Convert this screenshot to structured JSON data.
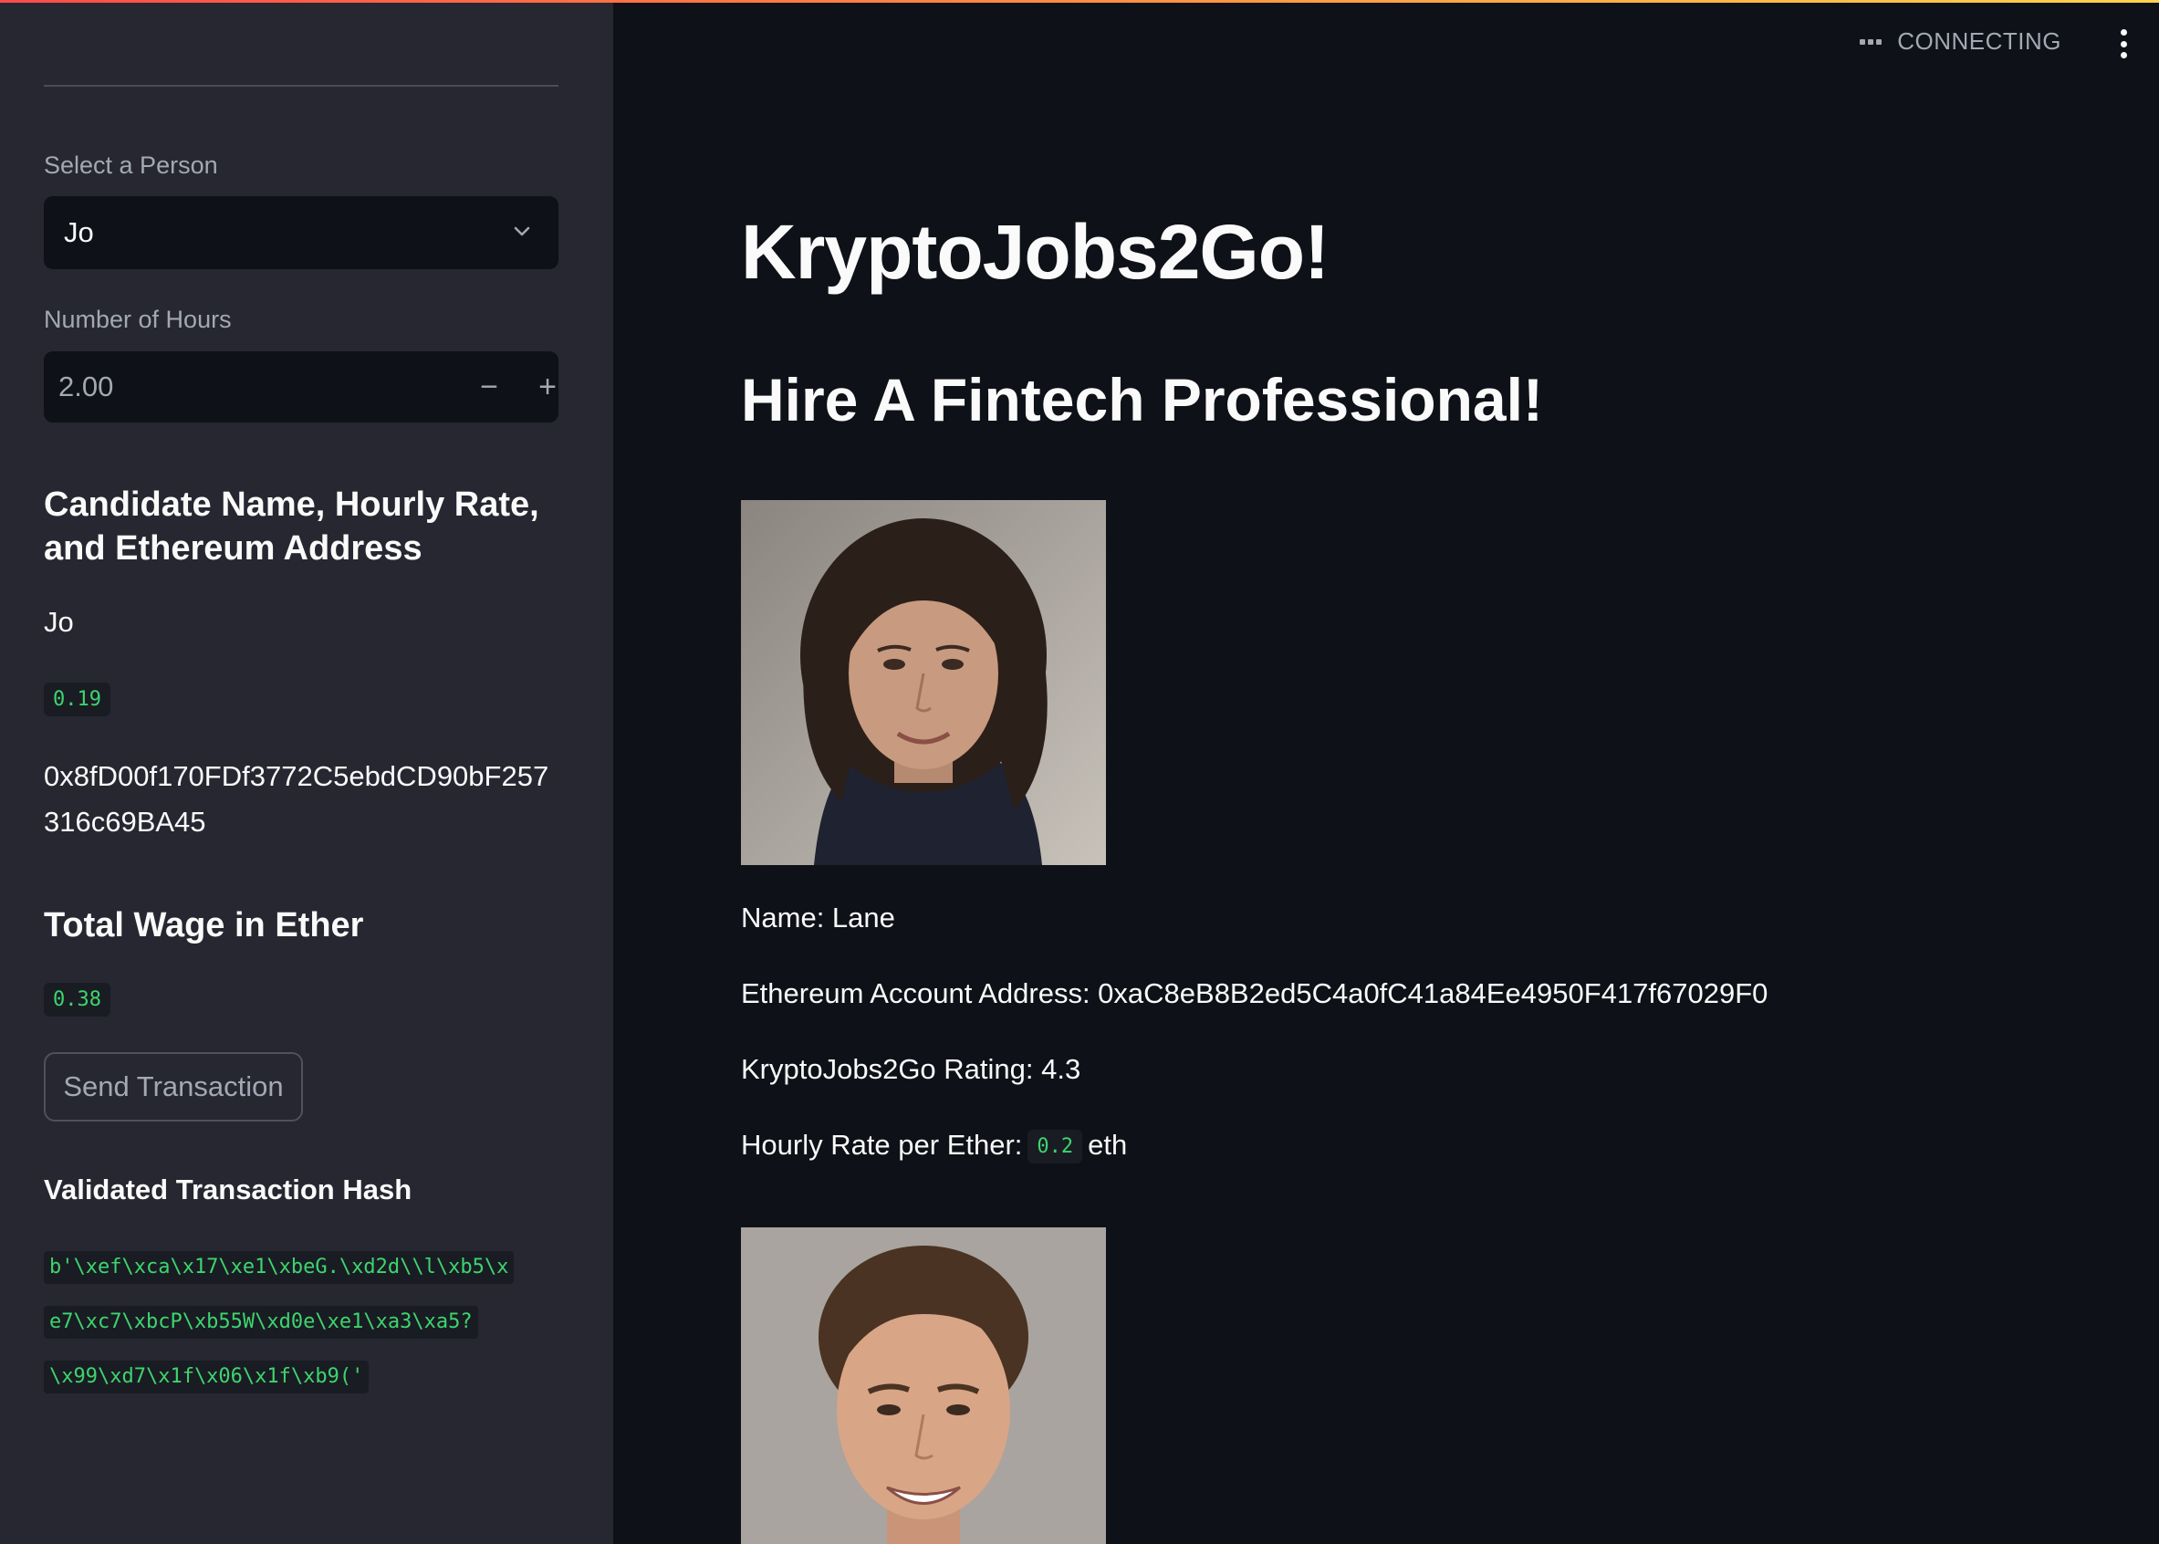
{
  "sidebar": {
    "select_label": "Select a Person",
    "select_value": "Jo",
    "hours_label": "Number of Hours",
    "hours_value": "2.00",
    "minus": "−",
    "plus": "+",
    "candidate_heading": "Candidate Name, Hourly Rate, and Ethereum Address",
    "candidate_name": "Jo",
    "candidate_rate": "0.19",
    "candidate_address": "0x8fD00f170FDf3772C5ebdCD90bF257316c69BA45",
    "total_heading": "Total Wage in Ether",
    "total_value": "0.38",
    "send_button": "Send Transaction",
    "hash_heading": "Validated Transaction Hash",
    "hash_lines": [
      "b'\\xef\\xca\\x17\\xe1\\xbeG.\\xd2d\\\\l\\xb5\\x",
      "e7\\xc7\\xbcP\\xb55W\\xd0e\\xe1\\xa3\\xa5?",
      "\\x99\\xd7\\x1f\\x06\\x1f\\xb9('"
    ]
  },
  "header": {
    "status": "CONNECTING"
  },
  "main": {
    "title": "KryptoJobs2Go!",
    "subtitle": "Hire A Fintech Professional!",
    "candidates": [
      {
        "name_line": "Name: Lane",
        "address_line": "Ethereum Account Address: 0xaC8eB8B2ed5C4a0fC41a84Ee4950F417f67029F0",
        "rating_line": "KryptoJobs2Go Rating: 4.3",
        "rate_prefix": "Hourly Rate per Ether:",
        "rate_value": "0.2",
        "rate_suffix": "eth"
      }
    ]
  },
  "colors": {
    "sidebar_bg": "#262730",
    "main_bg": "#0e1117",
    "code_green": "#3dd56d",
    "muted_text": "#a3a8b4"
  },
  "icons": [
    "chevron-down-icon",
    "minus-icon",
    "plus-icon",
    "status-dots-icon",
    "kebab-menu-icon"
  ]
}
